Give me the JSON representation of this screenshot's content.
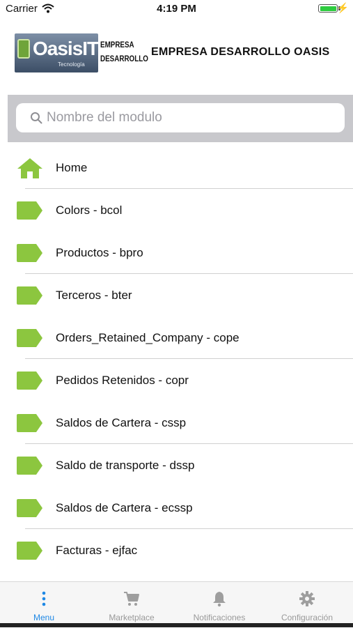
{
  "status_bar": {
    "carrier": "Carrier",
    "time": "4:19 PM",
    "battery_level": 1.0
  },
  "header": {
    "logo_text": "OasisIT",
    "logo_tagline": "Tecnología",
    "company_mark_line1": "EMPRESA",
    "company_mark_line2": "DESARROLLO",
    "company_title": "EMPRESA DESARROLLO OASIS"
  },
  "search": {
    "placeholder": "Nombre del modulo",
    "value": ""
  },
  "menu": {
    "items": [
      {
        "label": "Home",
        "icon": "home-icon"
      },
      {
        "label": "Colors - bcol",
        "icon": "tag-icon"
      },
      {
        "label": "Productos - bpro",
        "icon": "tag-icon"
      },
      {
        "label": "Terceros - bter",
        "icon": "tag-icon"
      },
      {
        "label": "Orders_Retained_Company - cope",
        "icon": "tag-icon"
      },
      {
        "label": "Pedidos Retenidos - copr",
        "icon": "tag-icon"
      },
      {
        "label": "Saldos de Cartera - cssp",
        "icon": "tag-icon"
      },
      {
        "label": "Saldo de transporte - dssp",
        "icon": "tag-icon"
      },
      {
        "label": "Saldos de Cartera - ecssp",
        "icon": "tag-icon"
      },
      {
        "label": "Facturas - ejfac",
        "icon": "tag-icon"
      }
    ]
  },
  "tabbar": {
    "tabs": [
      {
        "label": "Menu",
        "icon": "more-vertical-icon",
        "active": true
      },
      {
        "label": "Marketplace",
        "icon": "cart-icon",
        "active": false
      },
      {
        "label": "Notificaciones",
        "icon": "bell-icon",
        "active": false
      },
      {
        "label": "Configuración",
        "icon": "gear-icon",
        "active": false
      }
    ]
  },
  "colors": {
    "accent": "#1e88e5",
    "icon_green": "#8cc63f",
    "tab_inactive": "#999999"
  }
}
